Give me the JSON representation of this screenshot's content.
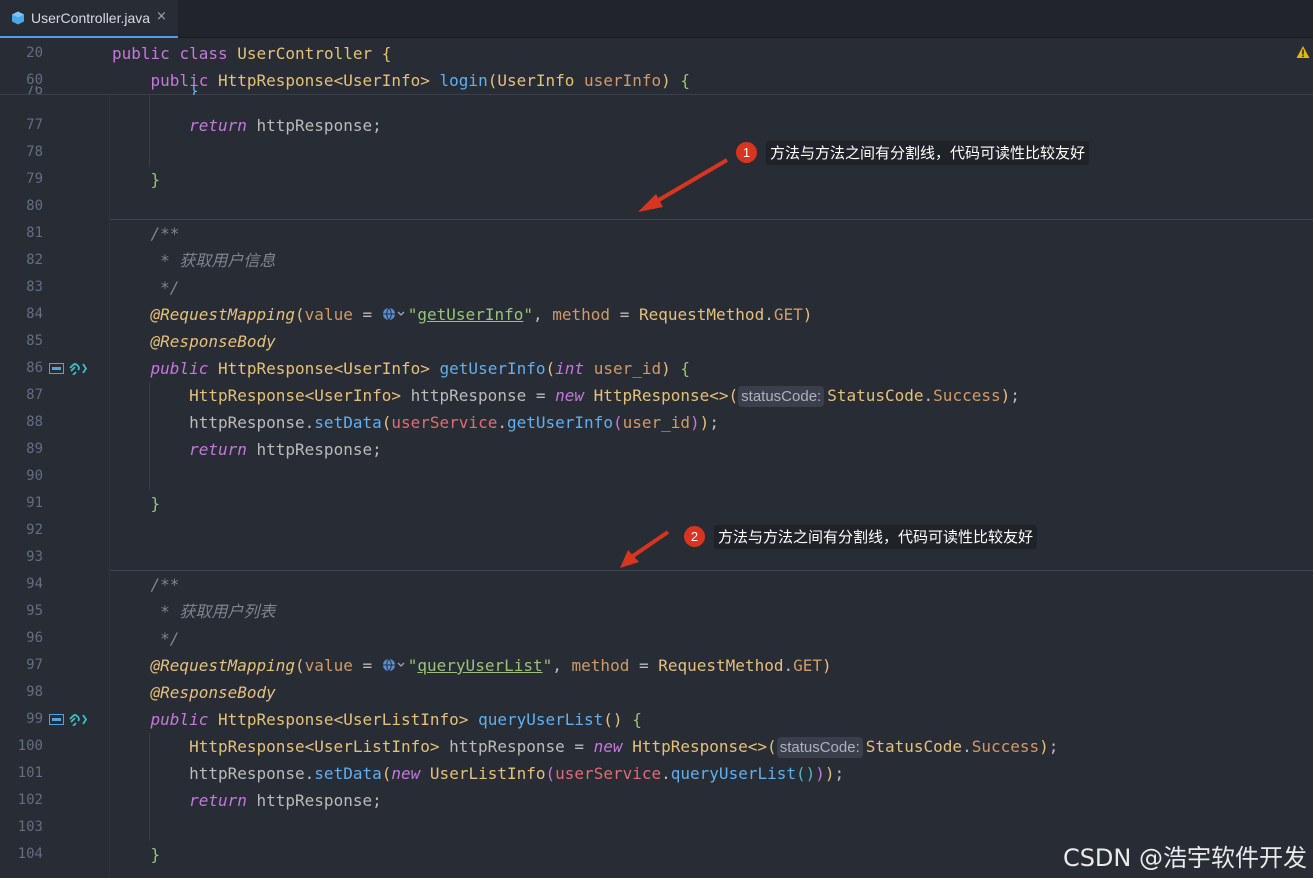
{
  "tab": {
    "file_name": "UserController.java",
    "close_glyph": "×",
    "icon": "java-class-icon"
  },
  "line_numbers": [
    "20",
    "60",
    "76",
    "77",
    "78",
    "79",
    "80",
    "81",
    "82",
    "83",
    "84",
    "85",
    "86",
    "87",
    "88",
    "89",
    "90",
    "91",
    "92",
    "93",
    "94",
    "95",
    "96",
    "97",
    "98",
    "99",
    "100",
    "101",
    "102",
    "103",
    "104"
  ],
  "code": {
    "l20": {
      "kw_public": "public",
      "kw_class": "class",
      "class_name": "UserController",
      "brace": "{"
    },
    "l60": {
      "kw_public": "public",
      "ret": "HttpResponse<UserInfo>",
      "method": "login",
      "lp": "(",
      "ptype": "UserInfo",
      "pname": "userInfo",
      "rp": ")",
      "brace": "{"
    },
    "l76": {
      "text": "}"
    },
    "l77": {
      "kw_return": "return",
      "rest": "httpResponse;"
    },
    "l79": {
      "text": "}"
    },
    "l81": {
      "text": "/**"
    },
    "l82": {
      "text": " * 获取用户信息"
    },
    "l83": {
      "text": " */"
    },
    "l84": {
      "annotation": "@RequestMapping",
      "lp": "(",
      "key1": "value",
      "eq": " = ",
      "q1": "\"",
      "path": "getUserInfo",
      "q2": "\"",
      "comma": ", ",
      "key2": "method",
      "eq2": " = ",
      "enum_type": "RequestMethod",
      "dot": ".",
      "enum_val": "GET",
      "rp": ")"
    },
    "l85": {
      "annotation": "@ResponseBody"
    },
    "l86": {
      "kw_public": "public",
      "ret": "HttpResponse<UserInfo>",
      "method": "getUserInfo",
      "lp": "(",
      "ptype": "int",
      "pname": "user_id",
      "rp": ")",
      "brace": "{"
    },
    "l87": {
      "type": "HttpResponse<UserInfo>",
      "var": " httpResponse = ",
      "kw_new": "new",
      "ctor": "HttpResponse<>",
      "lp": "(",
      "hint": "statusCode:",
      "enum_type": "StatusCode",
      "dot": ".",
      "enum_val": "Success",
      "rp": ")",
      "semi": ";"
    },
    "l88": {
      "obj": "httpResponse",
      "dot": ".",
      "call": "setData",
      "lp": "(",
      "field": "userService",
      "dot2": ".",
      "call2": "getUserInfo",
      "lp2": "(",
      "arg": "user_id",
      "rp2": ")",
      "rp": ")",
      "semi": ";"
    },
    "l89": {
      "kw_return": "return",
      "rest": "httpResponse;"
    },
    "l91": {
      "text": "}"
    },
    "l94": {
      "text": "/**"
    },
    "l95": {
      "text": " * 获取用户列表"
    },
    "l96": {
      "text": " */"
    },
    "l97": {
      "annotation": "@RequestMapping",
      "lp": "(",
      "key1": "value",
      "eq": " = ",
      "q1": "\"",
      "path": "queryUserList",
      "q2": "\"",
      "comma": ", ",
      "key2": "method",
      "eq2": " = ",
      "enum_type": "RequestMethod",
      "dot": ".",
      "enum_val": "GET",
      "rp": ")"
    },
    "l98": {
      "annotation": "@ResponseBody"
    },
    "l99": {
      "kw_public": "public",
      "ret": "HttpResponse<UserListInfo>",
      "method": "queryUserList",
      "parens": "()",
      "brace": "{"
    },
    "l100": {
      "type": "HttpResponse<UserListInfo>",
      "var": " httpResponse = ",
      "kw_new": "new",
      "ctor": "HttpResponse<>",
      "lp": "(",
      "hint": "statusCode:",
      "enum_type": "StatusCode",
      "dot": ".",
      "enum_val": "Success",
      "rp": ")",
      "semi": ";"
    },
    "l101": {
      "obj": "httpResponse",
      "dot": ".",
      "call": "setData",
      "lp": "(",
      "kw_new": "new",
      "ctor": "UserListInfo",
      "lp2": "(",
      "field": "userService",
      "dot2": ".",
      "call2": "queryUserList",
      "parens": "()",
      "rp2": ")",
      "rp": ")",
      "semi": ";"
    },
    "l102": {
      "kw_return": "return",
      "rest": "httpResponse;"
    },
    "l104": {
      "text": "}"
    }
  },
  "annotations": [
    {
      "number": "1",
      "text": "方法与方法之间有分割线，代码可读性比较友好"
    },
    {
      "number": "2",
      "text": "方法与方法之间有分割线，代码可读性比较友好"
    }
  ],
  "watermark": "CSDN @浩宇软件开发",
  "colors": {
    "background": "#282c34",
    "keyword": "#c678dd",
    "type": "#e5c07b",
    "function": "#61afef",
    "string": "#98c379",
    "comment": "#7f848e",
    "callout_badge": "#d7351f",
    "arrow": "#d7351f"
  }
}
